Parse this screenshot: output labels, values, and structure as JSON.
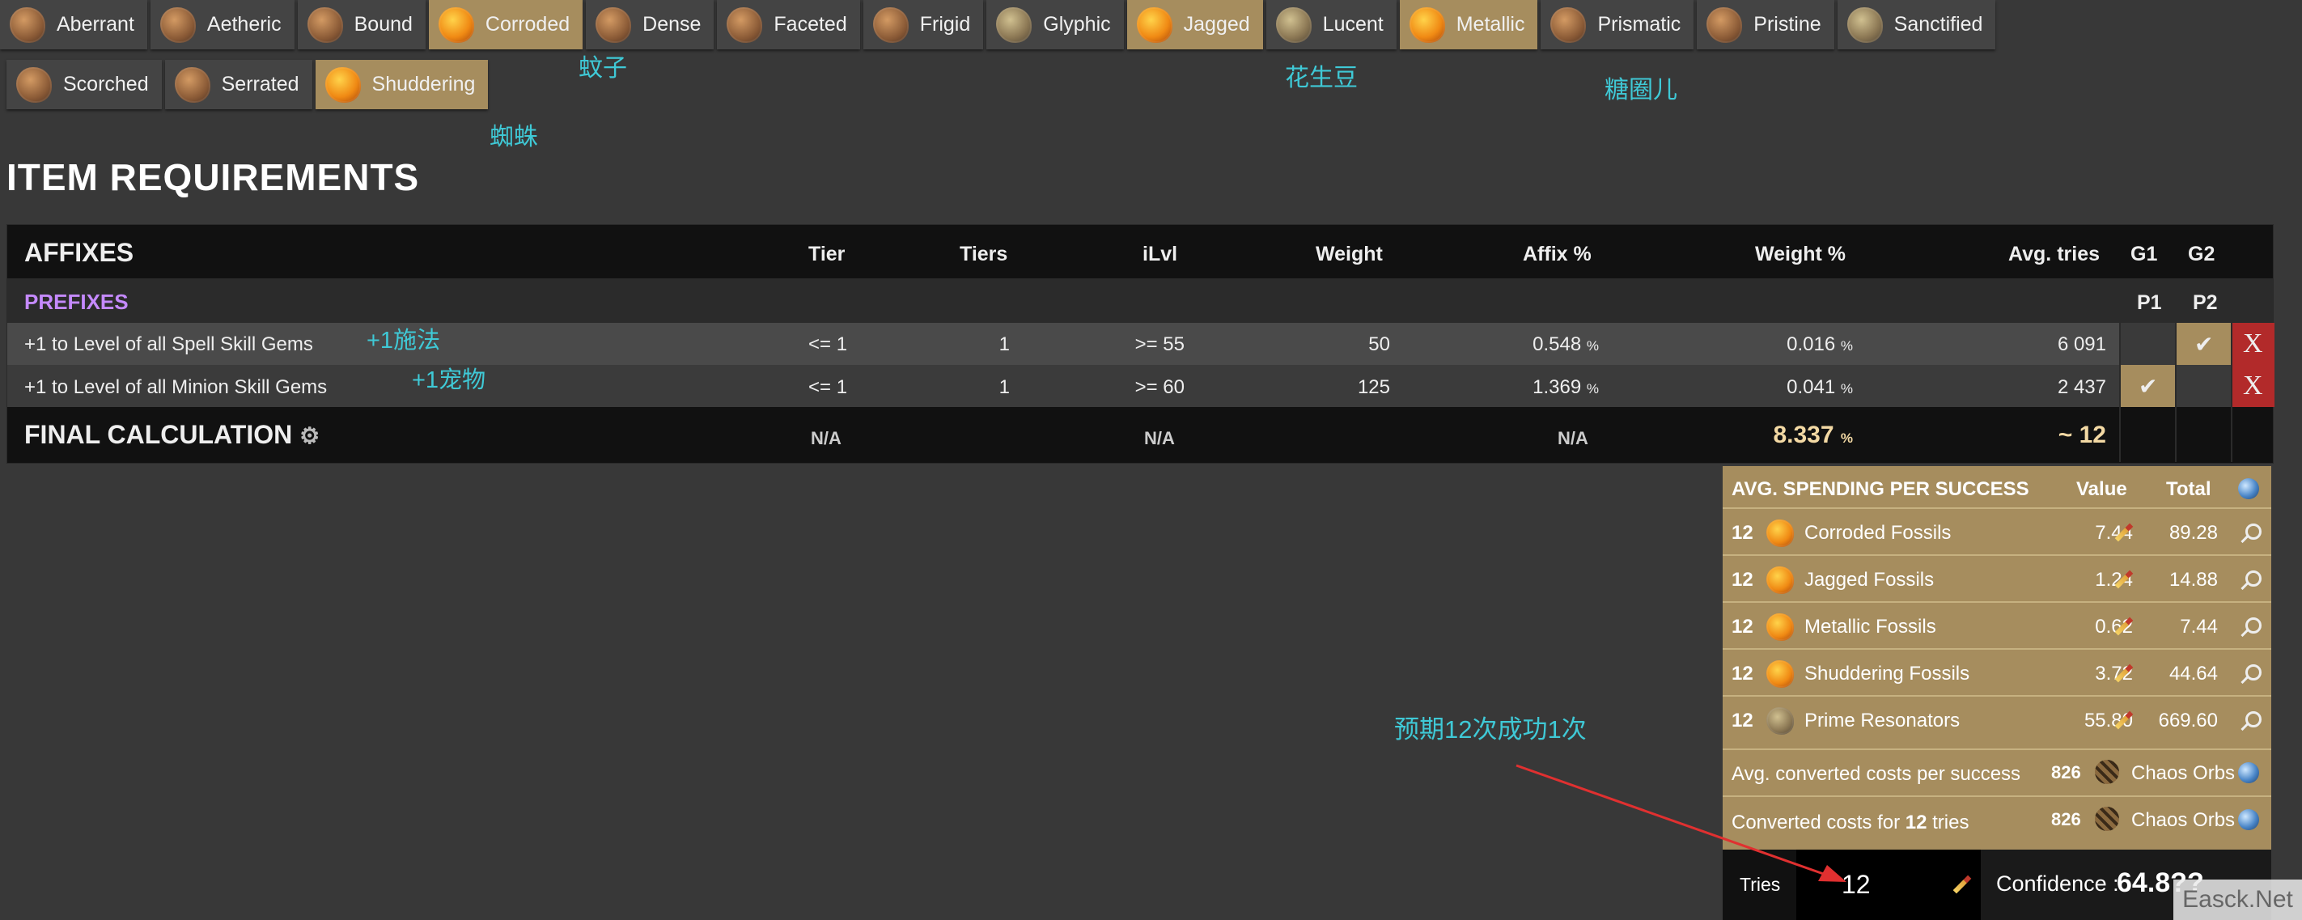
{
  "tabs_row1": [
    {
      "label": "Aberrant",
      "selected": false,
      "icon": "fossil-icon"
    },
    {
      "label": "Aetheric",
      "selected": false,
      "icon": "fossil-icon"
    },
    {
      "label": "Bound",
      "selected": false,
      "icon": "fossil-icon"
    },
    {
      "label": "Corroded",
      "selected": true,
      "icon": "fossil-icon"
    },
    {
      "label": "Dense",
      "selected": false,
      "icon": "fossil-icon"
    },
    {
      "label": "Faceted",
      "selected": false,
      "icon": "fossil-icon"
    },
    {
      "label": "Frigid",
      "selected": false,
      "icon": "fossil-icon"
    },
    {
      "label": "Glyphic",
      "selected": false,
      "icon": "fossil-icon"
    },
    {
      "label": "Jagged",
      "selected": true,
      "icon": "fossil-icon"
    },
    {
      "label": "Lucent",
      "selected": false,
      "icon": "fossil-icon"
    },
    {
      "label": "Metallic",
      "selected": true,
      "icon": "fossil-icon"
    },
    {
      "label": "Prismatic",
      "selected": false,
      "icon": "fossil-icon"
    },
    {
      "label": "Pristine",
      "selected": false,
      "icon": "fossil-icon"
    },
    {
      "label": "Sanctified",
      "selected": false,
      "icon": "fossil-icon"
    }
  ],
  "tabs_row2": [
    {
      "label": "Scorched",
      "selected": false,
      "icon": "fossil-icon"
    },
    {
      "label": "Serrated",
      "selected": false,
      "icon": "fossil-icon"
    },
    {
      "label": "Shuddering",
      "selected": true,
      "icon": "fossil-icon"
    }
  ],
  "annotations": {
    "corroded": "蚊子",
    "shuddering": "蜘蛛",
    "jagged": "花生豆",
    "metallic": "糖圈儿",
    "spell": "+1施法",
    "minion": "+1宠物",
    "expect": "预期12次成功1次"
  },
  "section_title": "ITEM REQUIREMENTS",
  "table": {
    "headers": {
      "affixes": "AFFIXES",
      "tier": "Tier",
      "tiers": "Tiers",
      "ilvl": "iLvl",
      "weight": "Weight",
      "affix_pct": "Affix %",
      "weight_pct": "Weight %",
      "avg_tries": "Avg. tries",
      "g1": "G1",
      "g2": "G2"
    },
    "prefixes_label": "PREFIXES",
    "p1": "P1",
    "p2": "P2",
    "rows": [
      {
        "name": "+1 to Level of all Spell Skill Gems",
        "tier": "<= 1",
        "tiers": "1",
        "ilvl": ">= 55",
        "weight": "50",
        "affix_pct": "0.548",
        "weight_pct": "0.016",
        "avg_tries": "6 091",
        "g1": "",
        "g2": "✔",
        "remove": "X"
      },
      {
        "name": "+1 to Level of all Minion Skill Gems",
        "tier": "<= 1",
        "tiers": "1",
        "ilvl": ">= 60",
        "weight": "125",
        "affix_pct": "1.369",
        "weight_pct": "0.041",
        "avg_tries": "2 437",
        "g1": "✔",
        "g2": "",
        "remove": "X"
      }
    ],
    "pct_sign": "%",
    "final": {
      "label": "FINAL CALCULATION",
      "tier": "N/A",
      "ilvl": "N/A",
      "affix_pct": "N/A",
      "weight_pct": "8.337",
      "avg_tries": "~ 12"
    }
  },
  "spending": {
    "title": "AVG. SPENDING PER SUCCESS",
    "value_header": "Value",
    "total_header": "Total",
    "rows": [
      {
        "count": "12",
        "name": "Corroded Fossils",
        "value": "7.44",
        "total": "89.28",
        "icon": "corroded-fossil-icon"
      },
      {
        "count": "12",
        "name": "Jagged Fossils",
        "value": "1.24",
        "total": "14.88",
        "icon": "jagged-fossil-icon"
      },
      {
        "count": "12",
        "name": "Metallic Fossils",
        "value": "0.62",
        "total": "7.44",
        "icon": "metallic-fossil-icon"
      },
      {
        "count": "12",
        "name": "Shuddering Fossils",
        "value": "3.72",
        "total": "44.64",
        "icon": "shuddering-fossil-icon"
      },
      {
        "count": "12",
        "name": "Prime Resonators",
        "value": "55.80",
        "total": "669.60",
        "icon": "prime-resonator-icon"
      }
    ],
    "converted_label": "Avg. converted costs per success",
    "converted_value": "826",
    "converted_currency": "Chaos Orbs",
    "converted_tries_prefix": "Converted costs for ",
    "converted_tries_count": "12",
    "converted_tries_suffix": " tries",
    "converted_tries_value": "826",
    "converted_tries_currency": "Chaos Orbs",
    "tries_label": "Tries",
    "tries_value": "12",
    "confidence_label": "Confidence :",
    "confidence_value": "64.8??"
  },
  "watermark": "Easck.Net"
}
